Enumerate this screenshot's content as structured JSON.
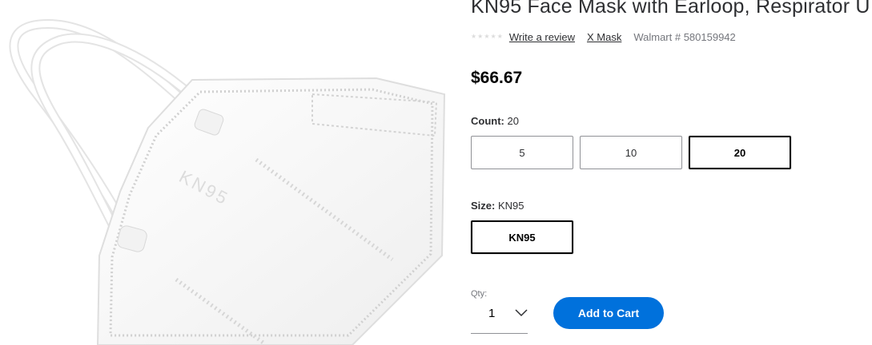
{
  "product": {
    "title": "KN95 Face Mask with Earloop, Respirator U",
    "rating_stars": 5,
    "write_review": "Write a review",
    "brand_link": "X Mask",
    "sku": "Walmart # 580159942",
    "price": "$66.67",
    "image_text": "KN95"
  },
  "count": {
    "label": "Count:",
    "selected": "20",
    "options": [
      "5",
      "10",
      "20"
    ]
  },
  "size": {
    "label": "Size:",
    "selected": "KN95",
    "options": [
      "KN95"
    ]
  },
  "qty": {
    "label": "Qty:",
    "value": "1"
  },
  "cart": {
    "add_label": "Add to Cart"
  },
  "colors": {
    "accent": "#0071dc",
    "text": "#2e2f32",
    "muted": "#74767c"
  }
}
